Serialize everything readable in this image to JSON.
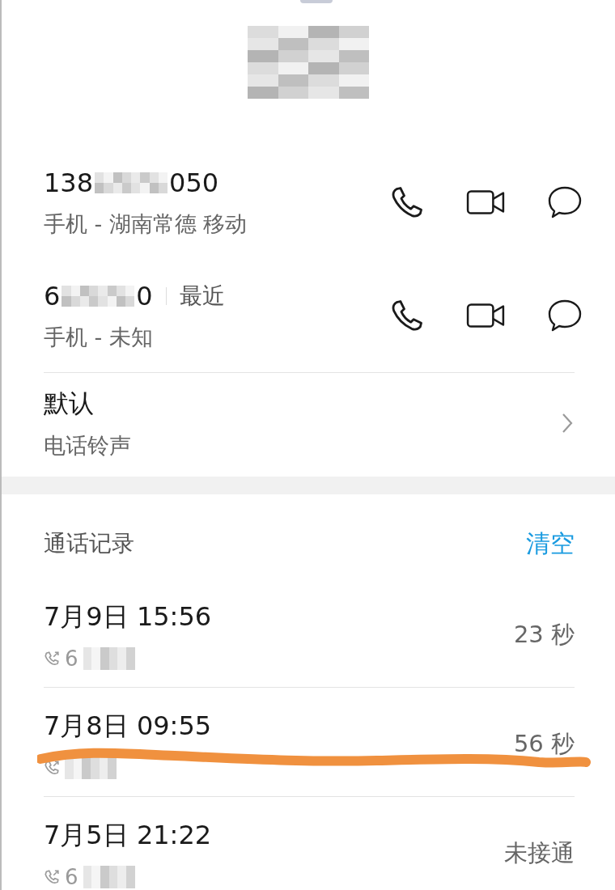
{
  "numbers": [
    {
      "number": "138",
      "tail": "050",
      "subtitle": "手机 - 湖南常德 移动"
    },
    {
      "number": "6",
      "tail": "0",
      "tag": "最近",
      "subtitle": "手机 - 未知"
    }
  ],
  "ringtone": {
    "title": "默认",
    "subtitle": "电话铃声"
  },
  "call_log": {
    "title": "通话记录",
    "clear_label": "清空",
    "entries": [
      {
        "time": "7月9日 15:56",
        "number": "6",
        "result": "23 秒"
      },
      {
        "time": "7月8日 09:55",
        "result": "56 秒"
      },
      {
        "time": "7月5日 21:22",
        "number": "6",
        "result": "未接通"
      }
    ]
  },
  "annotation": {
    "kind": "stroke",
    "color": "#f0913f"
  }
}
